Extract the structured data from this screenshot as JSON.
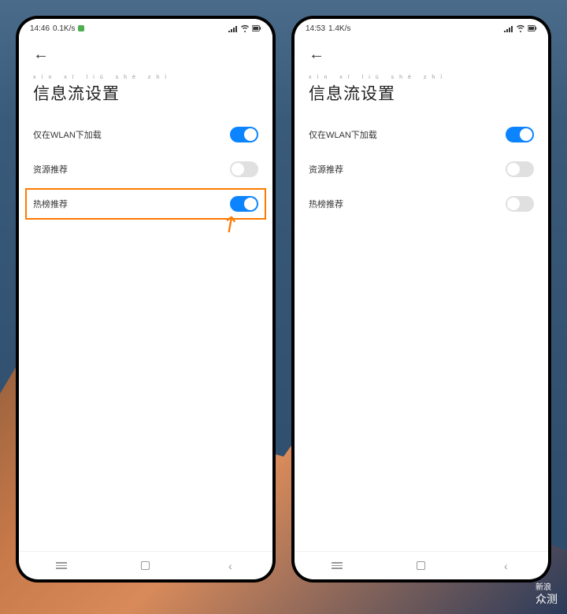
{
  "phone_left": {
    "status": {
      "time": "14:46",
      "speed": "0.1K/s"
    },
    "title_pinyin": "xìn xī liú shè zhì",
    "title": "信息流设置",
    "settings": [
      {
        "label": "仅在WLAN下加载",
        "on": true
      },
      {
        "label": "资源推荐",
        "on": false
      },
      {
        "label": "热榜推荐",
        "on": true
      }
    ]
  },
  "phone_right": {
    "status": {
      "time": "14:53",
      "speed": "1.4K/s"
    },
    "title_pinyin": "xìn xī liú shè zhì",
    "title": "信息流设置",
    "settings": [
      {
        "label": "仅在WLAN下加载",
        "on": true
      },
      {
        "label": "资源推荐",
        "on": false
      },
      {
        "label": "热榜推荐",
        "on": false
      }
    ]
  },
  "watermark": {
    "line1": "新浪",
    "line2": "众测"
  }
}
